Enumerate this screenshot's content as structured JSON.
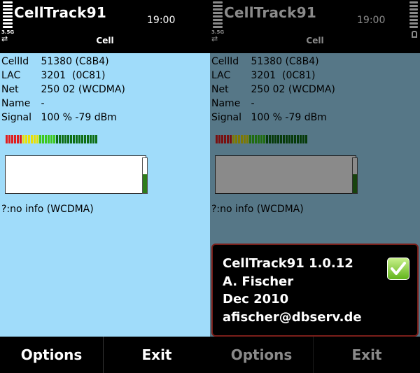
{
  "app": {
    "title": "CellTrack91",
    "time": "19:00",
    "screen_title": "Cell",
    "network_indicator": "3.5G"
  },
  "cell": {
    "rows": [
      {
        "label": "CellId",
        "value": "51380 (C8B4)"
      },
      {
        "label": "LAC",
        "value": "3201  (0C81)"
      },
      {
        "label": "Net",
        "value": "250 02 (WCDMA)"
      },
      {
        "label": "Name",
        "value": "-"
      },
      {
        "label": "Signal",
        "value": "100 % -79 dBm"
      }
    ],
    "neighbour_info": "?:no info (WCDMA)",
    "signal_level": 1.0,
    "graph_level": 0.55
  },
  "colors": {
    "background": "#a0dcfa",
    "meter_red": "#e01e1e",
    "meter_yellow": "#e8e00a",
    "meter_green": "#3cc81e",
    "meter_dark_green": "#0e6e14",
    "graph_fill": "#2e7d1a"
  },
  "about": {
    "line1": "CellTrack91 1.0.12",
    "line2": "A. Fischer",
    "line3": "Dec 2010",
    "line4": "afischer@dbserv.de",
    "icon": "check-icon"
  },
  "softkeys": {
    "left": "Options",
    "right": "Exit"
  },
  "icons": {
    "signal": "signal-strength-icon",
    "battery": "battery-icon",
    "network": "network-arrows-icon",
    "lock": "keylock-icon"
  }
}
